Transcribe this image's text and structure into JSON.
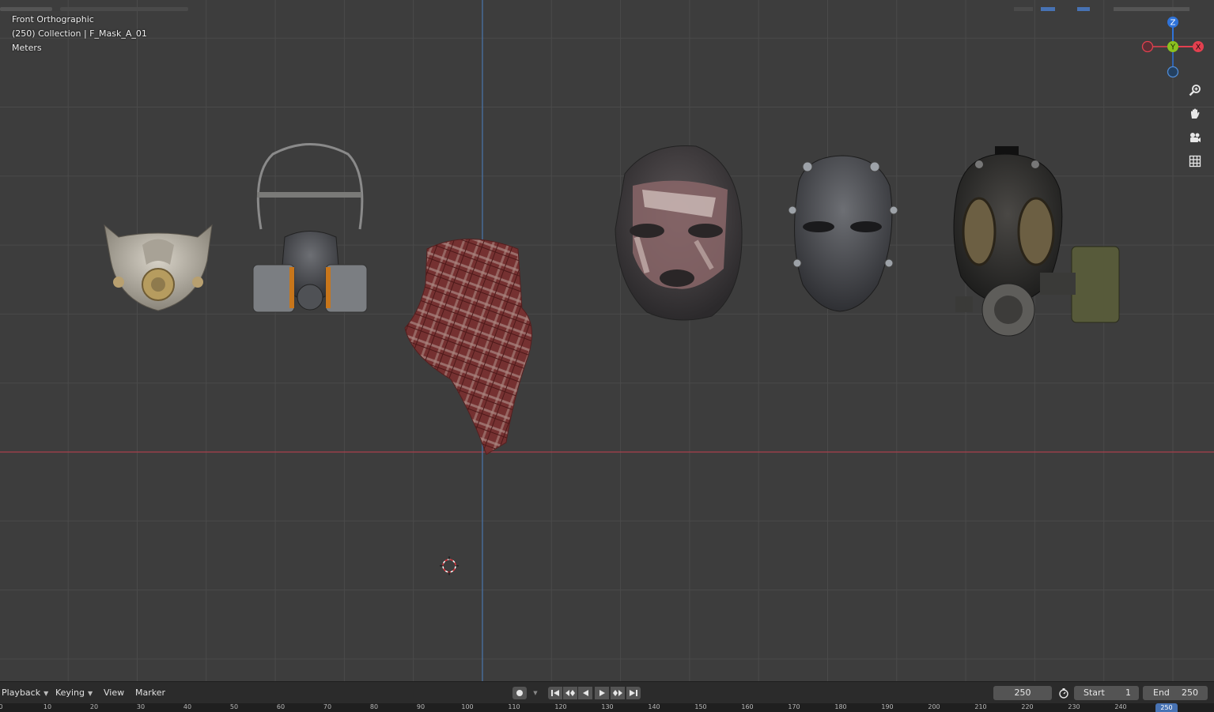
{
  "viewport": {
    "view_name": "Front Orthographic",
    "collection_info": "(250) Collection | F_Mask_A_01",
    "units": "Meters"
  },
  "gizmo": {
    "z_label": "Z",
    "y_label": "Y",
    "x_label": "X",
    "colors": {
      "z": "#2f73d9",
      "y": "#8bc21f",
      "x": "#e3404f",
      "neg": "#4f8bd6"
    }
  },
  "tools": [
    "zoom-icon",
    "hand-pan-icon",
    "camera-icon",
    "grid-ortho-icon"
  ],
  "objects": [
    "dust-mask",
    "respirator-half-mask",
    "red-plaid-scarf",
    "balaclava-mask",
    "hockey-style-mask",
    "gas-mask"
  ],
  "timeline": {
    "menus": {
      "playback": "Playback",
      "keying": "Keying",
      "view": "View",
      "marker": "Marker"
    },
    "current_frame": "250",
    "start_label": "Start",
    "start_value": "1",
    "end_label": "End",
    "end_value": "250",
    "ruler_ticks": [
      "0",
      "10",
      "20",
      "30",
      "40",
      "50",
      "60",
      "70",
      "80",
      "90",
      "100",
      "110",
      "120",
      "130",
      "140",
      "150",
      "160",
      "170",
      "180",
      "190",
      "200",
      "210",
      "220",
      "230",
      "240"
    ],
    "ruler_current": "250"
  },
  "colors": {
    "background": "#3d3d3d",
    "x_axis": "#a8404b",
    "z_axis": "#4a76ad",
    "accent": "#4772b3"
  }
}
